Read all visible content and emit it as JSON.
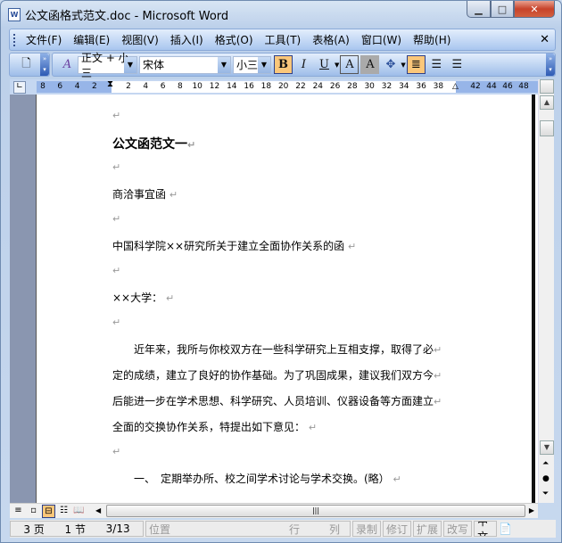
{
  "window": {
    "title": "公文函格式范文.doc - Microsoft Word",
    "app_icon": "W"
  },
  "menu": [
    "文件(F)",
    "编辑(E)",
    "视图(V)",
    "插入(I)",
    "格式(O)",
    "工具(T)",
    "表格(A)",
    "窗口(W)",
    "帮助(H)"
  ],
  "toolbar": {
    "style": "正文 + 小三",
    "font": "宋体",
    "size": "小三",
    "bold": "B",
    "italic": "I",
    "underline": "U",
    "border": "A",
    "shade": "A"
  },
  "ruler": {
    "left": [
      "8",
      "6",
      "4",
      "2"
    ],
    "mid": [
      "2",
      "4",
      "6",
      "8",
      "10",
      "12",
      "14",
      "16",
      "18",
      "20",
      "22",
      "24",
      "26",
      "28",
      "30",
      "32",
      "34",
      "36",
      "38"
    ],
    "right": [
      "42",
      "44",
      "46",
      "48"
    ]
  },
  "document": {
    "paragraphs": [
      "",
      "公文函范文一",
      "",
      "商洽事宜函 ",
      "",
      "中国科学院××研究所关于建立全面协作关系的函 ",
      "",
      "××大学： ",
      "",
      "　　近年来，我所与你校双方在一些科学研究上互相支撑，取得了必",
      "定的成绩，建立了良好的协作基础。为了巩固成果，建议我们双方今",
      "后能进一步在学术思想、科学研究、人员培训、仪器设备等方面建立",
      "全面的交换协作关系，特提出如下意见： ",
      "",
      "　　一、　定期举办所、校之间学术讨论与学术交换。(略） "
    ],
    "para_mark": "↵"
  },
  "status": {
    "page": "3 页",
    "section": "1 节",
    "pages": "3/13",
    "position": "位置",
    "line": "行",
    "col": "列",
    "rec": "录制",
    "trk": "修订",
    "ext": "扩展",
    "ovr": "改写",
    "lang": "中文"
  },
  "scroll": {
    "vertical_position": 0.17
  }
}
